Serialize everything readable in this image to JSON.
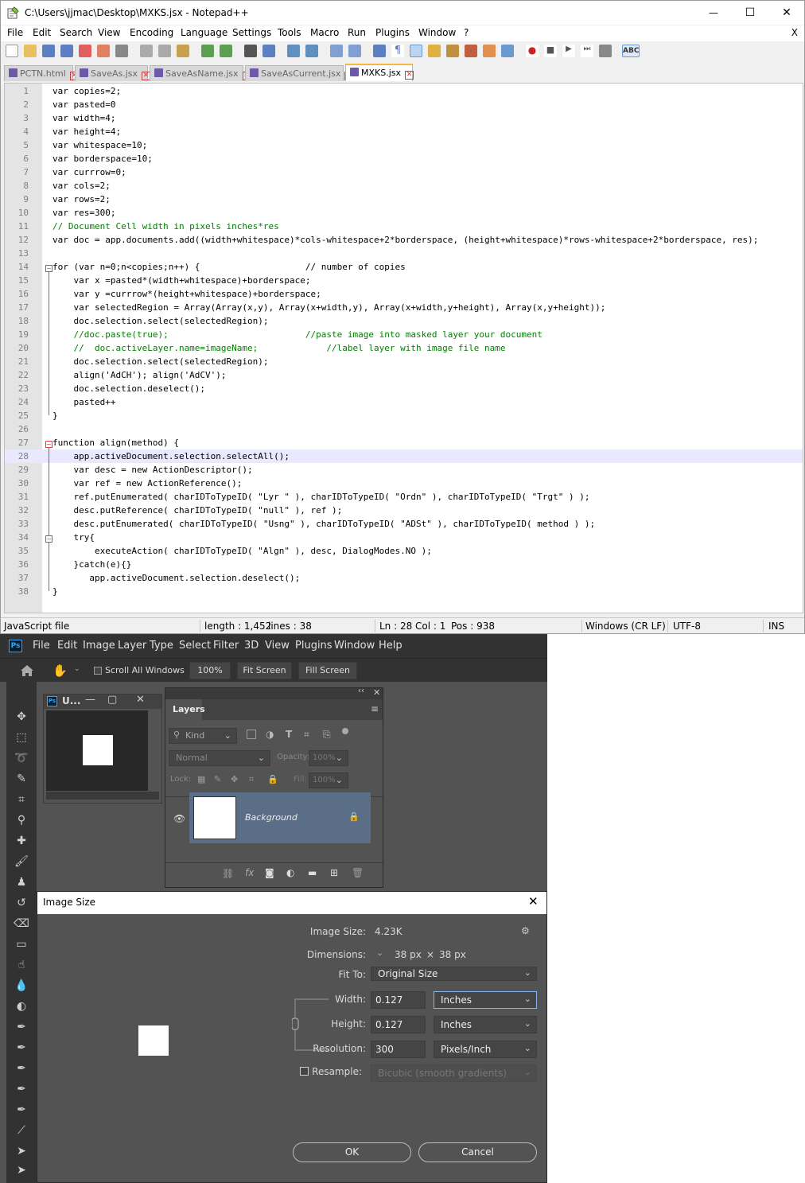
{
  "notepad": {
    "title": "C:\\Users\\jjmac\\Desktop\\MXKS.jsx - Notepad++",
    "window_controls": {
      "minimize": "—",
      "maximize": "☐",
      "close": "✕"
    },
    "menu": [
      "File",
      "Edit",
      "Search",
      "View",
      "Encoding",
      "Language",
      "Settings",
      "Tools",
      "Macro",
      "Run",
      "Plugins",
      "Window",
      "?"
    ],
    "menu_close": "X",
    "tabs": [
      {
        "label": "PCTN.html",
        "active": false
      },
      {
        "label": "SaveAs.jsx",
        "active": false
      },
      {
        "label": "SaveAsName.jsx",
        "active": false
      },
      {
        "label": "SaveAsCurrent.jsx",
        "active": false
      },
      {
        "label": "MXKS.jsx",
        "active": true
      }
    ],
    "lines": [
      {
        "n": "1",
        "t": "var copies=2;"
      },
      {
        "n": "2",
        "t": "var pasted=0"
      },
      {
        "n": "3",
        "t": "var width=4;"
      },
      {
        "n": "4",
        "t": "var height=4;"
      },
      {
        "n": "5",
        "t": "var whitespace=10;"
      },
      {
        "n": "6",
        "t": "var borderspace=10;"
      },
      {
        "n": "7",
        "t": "var currrow=0;"
      },
      {
        "n": "8",
        "t": "var cols=2;"
      },
      {
        "n": "9",
        "t": "var rows=2;"
      },
      {
        "n": "10",
        "t": "var res=300;"
      },
      {
        "n": "11",
        "t": "// Document Cell width in pixels inches*res"
      },
      {
        "n": "12",
        "t": "var doc = app.documents.add((width+whitespace)*cols-whitespace+2*borderspace, (height+whitespace)*rows-whitespace+2*borderspace, res);"
      },
      {
        "n": "13",
        "t": ""
      },
      {
        "n": "14",
        "t": "for (var n=0;n<copies;n++) {                    // number of copies"
      },
      {
        "n": "15",
        "t": "    var x =pasted*(width+whitespace)+borderspace;"
      },
      {
        "n": "16",
        "t": "    var y =currrow*(height+whitespace)+borderspace;"
      },
      {
        "n": "17",
        "t": "    var selectedRegion = Array(Array(x,y), Array(x+width,y), Array(x+width,y+height), Array(x,y+height));"
      },
      {
        "n": "18",
        "t": "    doc.selection.select(selectedRegion);"
      },
      {
        "n": "19",
        "t": "    //doc.paste(true);                          //paste image into masked layer your document"
      },
      {
        "n": "20",
        "t": "    //  doc.activeLayer.name=imageName;             //label layer with image file name"
      },
      {
        "n": "21",
        "t": "    doc.selection.select(selectedRegion);"
      },
      {
        "n": "22",
        "t": "    align('AdCH'); align('AdCV');"
      },
      {
        "n": "23",
        "t": "    doc.selection.deselect();"
      },
      {
        "n": "24",
        "t": "    pasted++"
      },
      {
        "n": "25",
        "t": "}"
      },
      {
        "n": "26",
        "t": ""
      },
      {
        "n": "27",
        "t": "function align(method) {"
      },
      {
        "n": "28",
        "t": "    app.activeDocument.selection.selectAll();"
      },
      {
        "n": "29",
        "t": "    var desc = new ActionDescriptor();"
      },
      {
        "n": "30",
        "t": "    var ref = new ActionReference();"
      },
      {
        "n": "31",
        "t": "    ref.putEnumerated( charIDToTypeID( \"Lyr \" ), charIDToTypeID( \"Ordn\" ), charIDToTypeID( \"Trgt\" ) );"
      },
      {
        "n": "32",
        "t": "    desc.putReference( charIDToTypeID( \"null\" ), ref );"
      },
      {
        "n": "33",
        "t": "    desc.putEnumerated( charIDToTypeID( \"Usng\" ), charIDToTypeID( \"ADSt\" ), charIDToTypeID( method ) );"
      },
      {
        "n": "34",
        "t": "    try{"
      },
      {
        "n": "35",
        "t": "        executeAction( charIDToTypeID( \"Algn\" ), desc, DialogModes.NO );"
      },
      {
        "n": "36",
        "t": "    }catch(e){}"
      },
      {
        "n": "37",
        "t": "       app.activeDocument.selection.deselect();"
      },
      {
        "n": "38",
        "t": "}"
      }
    ],
    "status": {
      "type": "JavaScript file",
      "length": "length : 1,452",
      "lines": "lines : 38",
      "ln": "Ln : 28",
      "col": "Col : 1",
      "pos": "Pos : 938",
      "eol": "Windows (CR LF)",
      "enc": "UTF-8",
      "mode": "INS"
    }
  },
  "photoshop": {
    "logo": "Ps",
    "menu": [
      "File",
      "Edit",
      "Image",
      "Layer",
      "Type",
      "Select",
      "Filter",
      "3D",
      "View",
      "Plugins",
      "Window",
      "Help"
    ],
    "options": {
      "scroll_all": "Scroll All Windows",
      "zoom": "100%",
      "fit": "Fit Screen",
      "fill": "Fill Screen"
    },
    "doc_title": "U...",
    "layers": {
      "tab": "Layers",
      "kind": "Kind",
      "blend": "Normal",
      "opacity_label": "Opacity:",
      "opacity": "100%",
      "lock_label": "Lock:",
      "fill_label": "Fill:",
      "fill": "100%",
      "layer_name": "Background"
    },
    "image_size": {
      "title": "Image Size",
      "size_label": "Image Size:",
      "size": "4.23K",
      "dims_label": "Dimensions:",
      "dim_w": "38 px",
      "dim_x": "×",
      "dim_h": "38 px",
      "fit_label": "Fit To:",
      "fit": "Original Size",
      "width_label": "Width:",
      "width": "0.127",
      "width_unit": "Inches",
      "height_label": "Height:",
      "height": "0.127",
      "height_unit": "Inches",
      "res_label": "Resolution:",
      "res": "300",
      "res_unit": "Pixels/Inch",
      "resample_label": "Resample:",
      "resample": "Bicubic (smooth gradients)",
      "ok": "OK",
      "cancel": "Cancel"
    }
  }
}
